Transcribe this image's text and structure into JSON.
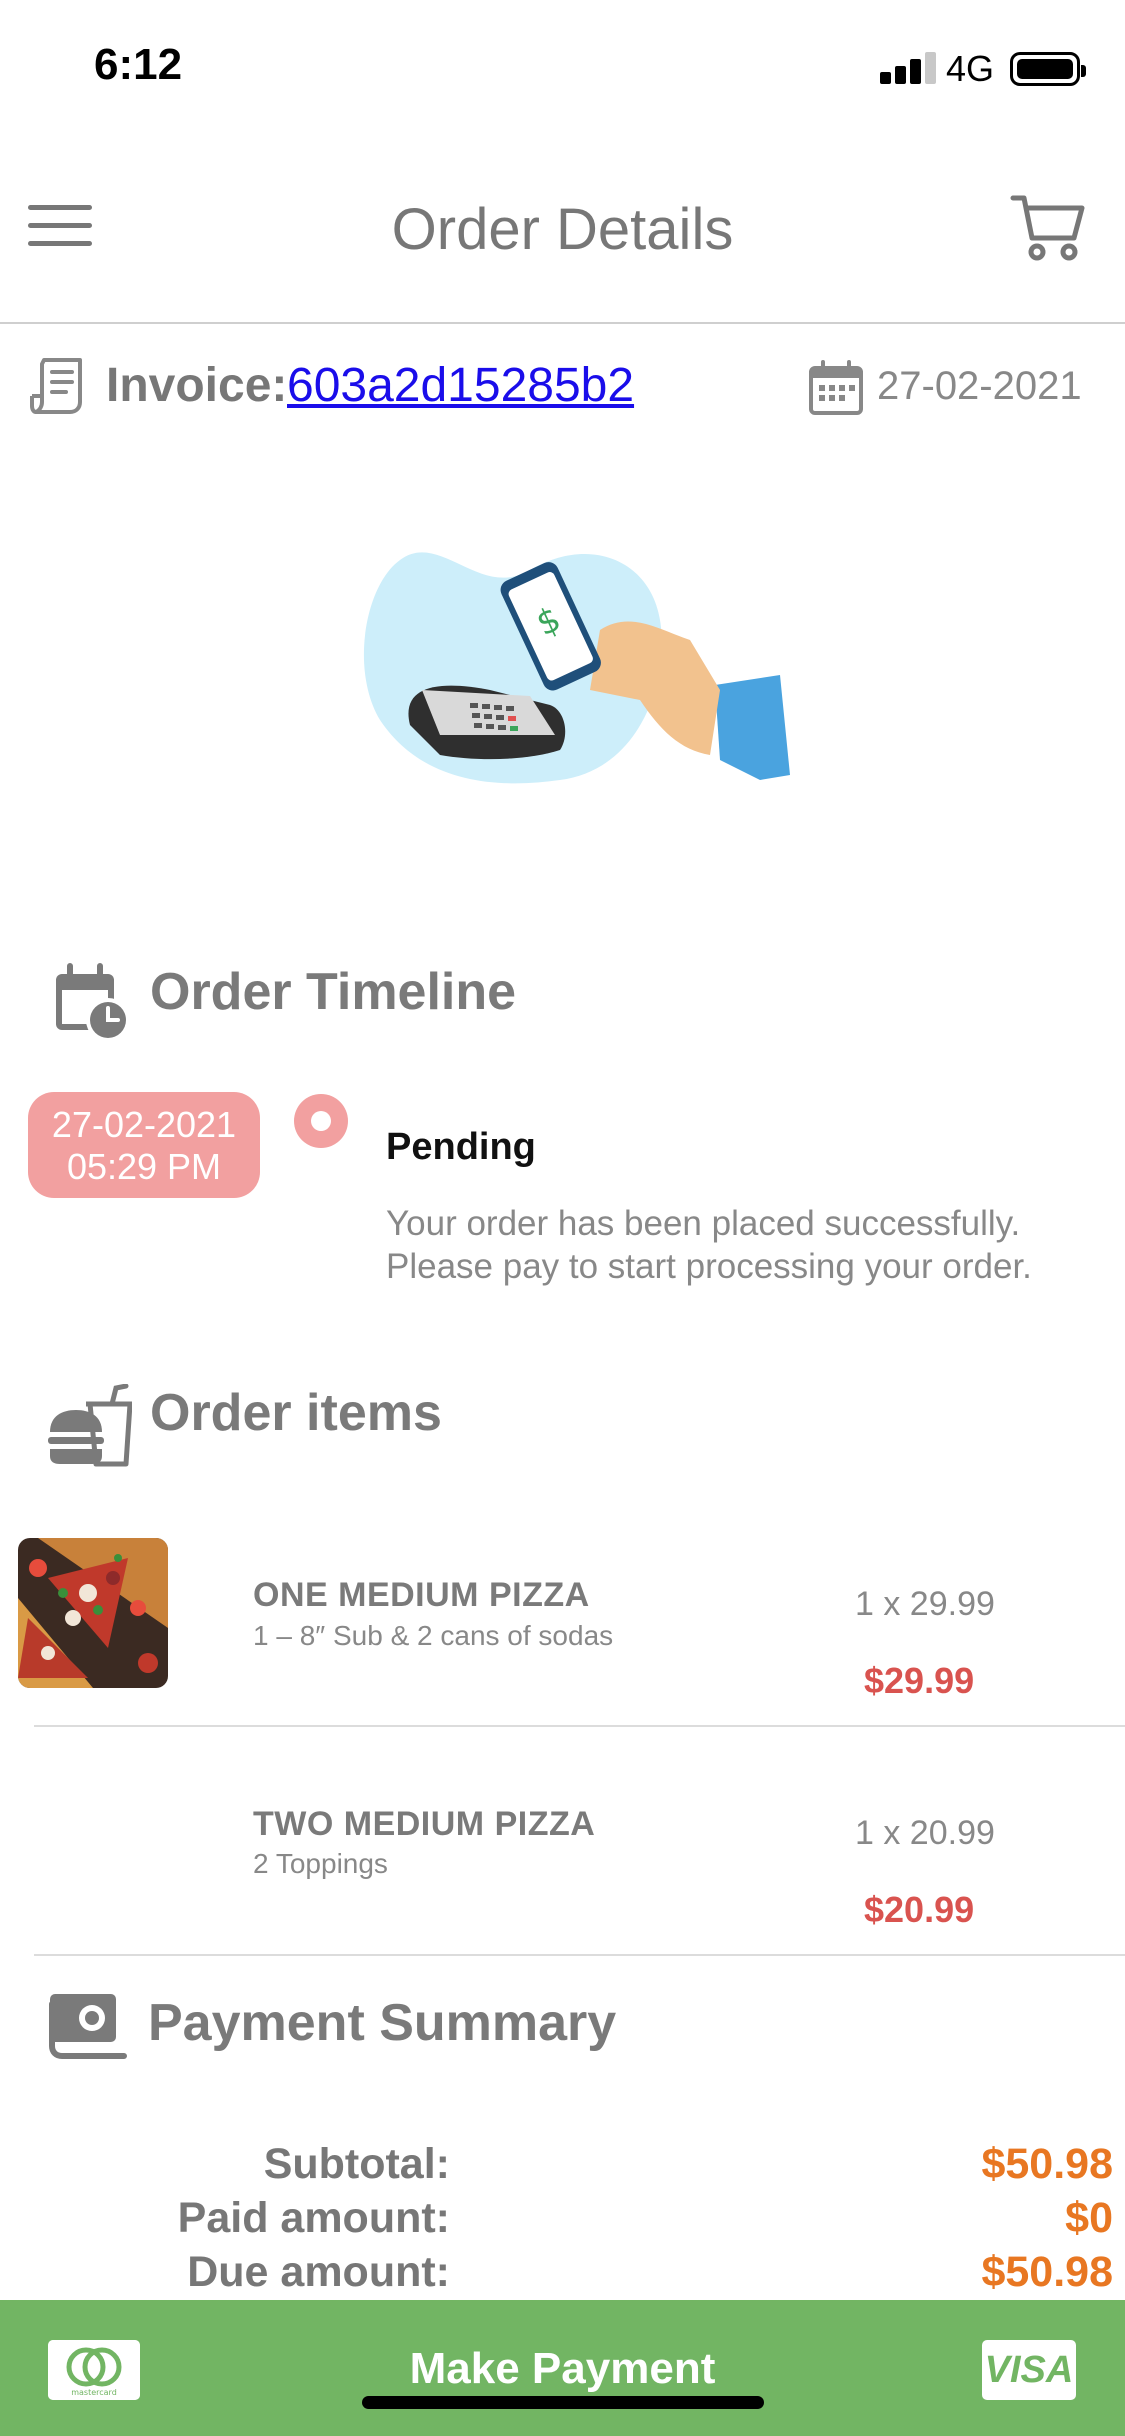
{
  "status_bar": {
    "time": "6:12",
    "network": "4G"
  },
  "header": {
    "title": "Order Details",
    "menu_icon": "hamburger-menu-icon",
    "cart_icon": "shopping-cart-icon"
  },
  "invoice": {
    "label": "Invoice:",
    "number": "603a2d15285b2",
    "date": "27-02-2021"
  },
  "timeline": {
    "title": "Order Timeline",
    "entries": [
      {
        "date": "27-02-2021",
        "time": "05:29 PM",
        "status": "Pending",
        "description": "Your order has been placed successfully. Please pay to start processing your order."
      }
    ]
  },
  "order_items": {
    "title": "Order items",
    "items": [
      {
        "name": "ONE MEDIUM PIZZA",
        "description": "1 – 8″ Sub & 2 cans of sodas",
        "quantity": "1 x 29.99",
        "price": "$29.99",
        "has_image": true
      },
      {
        "name": "TWO MEDIUM PIZZA",
        "description": "2 Toppings",
        "quantity": "1 x 20.99",
        "price": "$20.99",
        "has_image": false
      }
    ]
  },
  "payment_summary": {
    "title": "Payment Summary",
    "subtotal_label": "Subtotal:",
    "subtotal_value": "$50.98",
    "paid_label": "Paid amount:",
    "paid_value": "$0",
    "due_label": "Due amount:",
    "due_value": "$50.98"
  },
  "pay_bar": {
    "label": "Make Payment",
    "mastercard_text": "mastercard",
    "visa_text": "VISA"
  },
  "colors": {
    "accent_green": "#72b563",
    "timeline_pink": "#f2a0a0",
    "price_red": "#d9534f",
    "summary_orange": "#e87722",
    "link_blue": "#1a0dea"
  }
}
